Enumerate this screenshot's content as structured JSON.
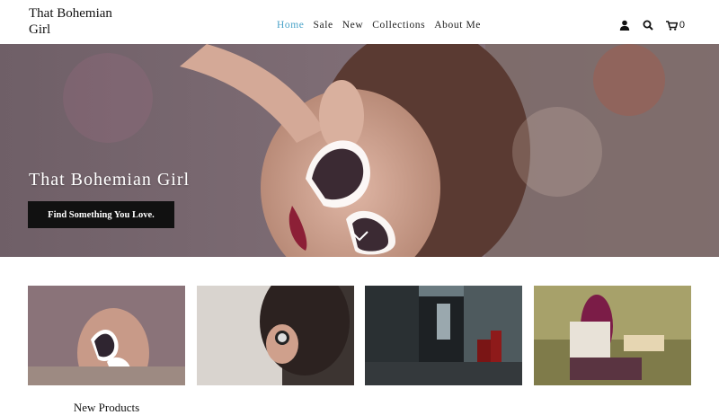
{
  "header": {
    "logo": "That Bohemian Girl",
    "nav": [
      {
        "label": "Home",
        "active": true
      },
      {
        "label": "Sale",
        "active": false
      },
      {
        "label": "New",
        "active": false
      },
      {
        "label": "Collections",
        "active": false
      },
      {
        "label": "About Me",
        "active": false
      }
    ],
    "icons": [
      "user-icon",
      "search-icon",
      "cart-icon"
    ],
    "cart_count": "0",
    "accent_color": "#4aa3c8"
  },
  "hero": {
    "title": "That Bohemian Girl",
    "button_label": "Find Something You Love.",
    "scroll_icon": "chevron-down-icon"
  },
  "products": [
    {
      "caption": "New Products"
    },
    {
      "caption": ""
    },
    {
      "caption": ""
    },
    {
      "caption": ""
    }
  ]
}
